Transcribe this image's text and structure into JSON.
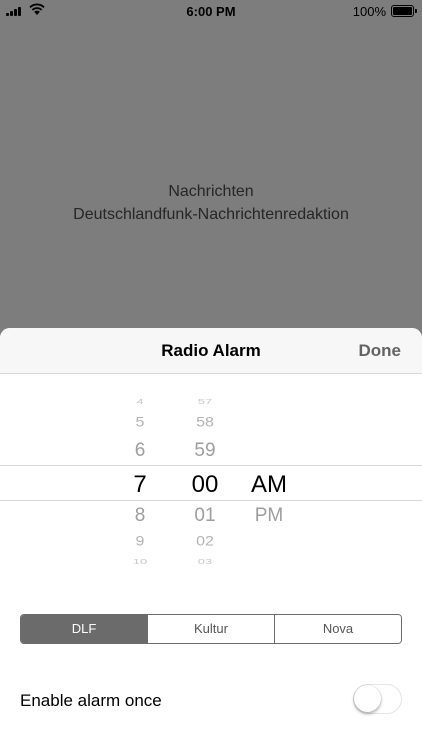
{
  "status_bar": {
    "time": "6:00 PM",
    "battery_percent": "100%",
    "signal_icon": "cellular-signal-icon",
    "wifi_icon": "wifi-icon",
    "battery_icon": "battery-icon"
  },
  "background": {
    "line1": "Nachrichten",
    "line2": "Deutschlandfunk-Nachrichtenredaktion"
  },
  "sheet": {
    "title": "Radio Alarm",
    "done_label": "Done"
  },
  "picker": {
    "hours": [
      "4",
      "5",
      "6",
      "7",
      "8",
      "9",
      "10"
    ],
    "minutes": [
      "57",
      "58",
      "59",
      "00",
      "01",
      "02",
      "03"
    ],
    "ampm": [
      "AM",
      "PM"
    ],
    "selected_hour": "7",
    "selected_minute": "00",
    "selected_ampm": "AM"
  },
  "stations": {
    "items": [
      "DLF",
      "Kultur",
      "Nova"
    ],
    "selected": "DLF"
  },
  "alarm_once": {
    "label": "Enable alarm once",
    "enabled": false
  },
  "colors": {
    "dim_background": "#7d7d7d",
    "accent": "#6b6b6b"
  }
}
